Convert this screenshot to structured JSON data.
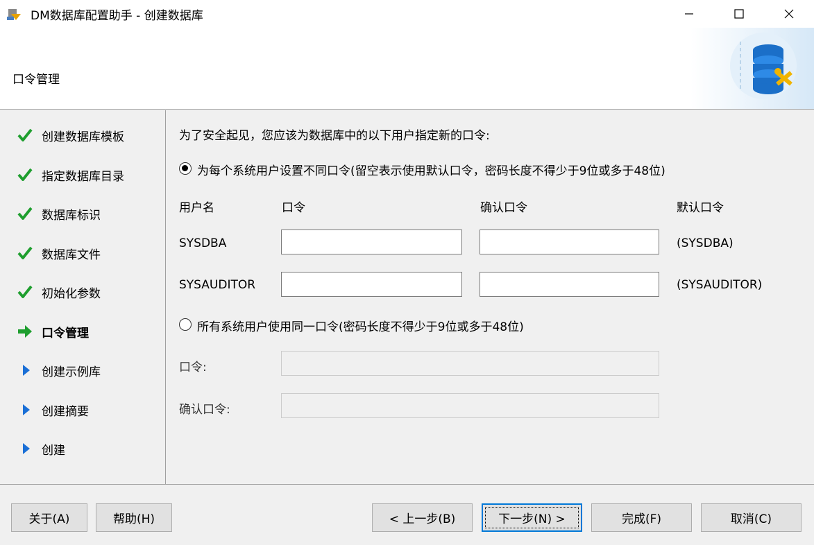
{
  "window": {
    "title": "DM数据库配置助手 - 创建数据库",
    "controls": {
      "minimize": "—",
      "maximize": "☐",
      "close": "✕"
    }
  },
  "header": {
    "title": "口令管理",
    "logo_icon": "database-tools-icon"
  },
  "sidebar": {
    "steps": [
      {
        "label": "创建数据库模板",
        "state": "done",
        "icon": "checkmark-icon"
      },
      {
        "label": "指定数据库目录",
        "state": "done",
        "icon": "checkmark-icon"
      },
      {
        "label": "数据库标识",
        "state": "done",
        "icon": "checkmark-icon"
      },
      {
        "label": "数据库文件",
        "state": "done",
        "icon": "checkmark-icon"
      },
      {
        "label": "初始化参数",
        "state": "done",
        "icon": "checkmark-icon"
      },
      {
        "label": "口令管理",
        "state": "current",
        "icon": "arrow-right-icon"
      },
      {
        "label": "创建示例库",
        "state": "pending",
        "icon": "triangle-right-icon"
      },
      {
        "label": "创建摘要",
        "state": "pending",
        "icon": "triangle-right-icon"
      },
      {
        "label": "创建",
        "state": "pending",
        "icon": "triangle-right-icon"
      }
    ]
  },
  "main": {
    "intro": "为了安全起见，您应该为数据库中的以下用户指定新的口令:",
    "option_individual": {
      "label": "为每个系统用户设置不同口令(留空表示使用默认口令，密码长度不得少于9位或多于48位)",
      "checked": true
    },
    "columns": {
      "username": "用户名",
      "password": "口令",
      "confirm": "确认口令",
      "default": "默认口令"
    },
    "users": [
      {
        "name": "SYSDBA",
        "password": "",
        "confirm": "",
        "default": "(SYSDBA)"
      },
      {
        "name": "SYSAUDITOR",
        "password": "",
        "confirm": "",
        "default": "(SYSAUDITOR)"
      }
    ],
    "option_same": {
      "label": "所有系统用户使用同一口令(密码长度不得少于9位或多于48位)",
      "checked": false
    },
    "same_password_label": "口令:",
    "same_password_value": "",
    "same_confirm_label": "确认口令:",
    "same_confirm_value": ""
  },
  "footer": {
    "about": "关于(A)",
    "help": "帮助(H)",
    "prev": "< 上一步(B)",
    "next": "下一步(N) >",
    "finish": "完成(F)",
    "cancel": "取消(C)"
  },
  "colors": {
    "check_green": "#1e9e2e",
    "arrow_green": "#1e9e2e",
    "pending_blue": "#1a6fd6",
    "accent": "#0078d7"
  }
}
